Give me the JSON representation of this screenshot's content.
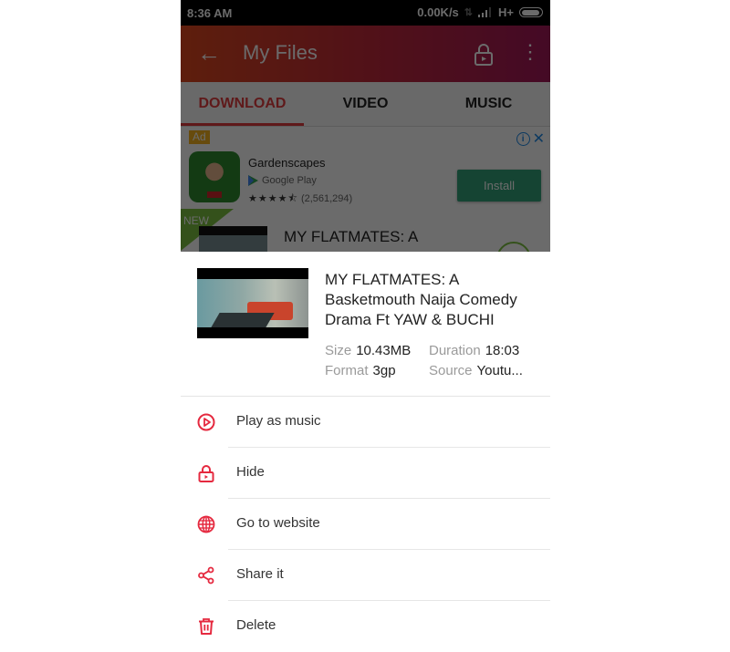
{
  "status_bar": {
    "time": "8:36 AM",
    "network_speed": "0.00K/s",
    "network_type": "H+"
  },
  "app_bar": {
    "title": "My Files",
    "icons": [
      "back-arrow-icon",
      "video-lock-icon",
      "more-vert-icon"
    ]
  },
  "tabs": [
    {
      "label": "DOWNLOAD",
      "active": true
    },
    {
      "label": "VIDEO",
      "active": false
    },
    {
      "label": "MUSIC",
      "active": false
    }
  ],
  "ad": {
    "badge": "Ad",
    "app_name": "Gardenscapes",
    "store": "Google Play",
    "stars": "★★★★⯪",
    "rating_count": "(2,561,294)",
    "install_label": "Install",
    "colors": {
      "install": "#34a37a",
      "badge": "#f5b321"
    }
  },
  "list_item": {
    "badge": "NEW",
    "title": "MY FLATMATES: A"
  },
  "sheet": {
    "title": "MY FLATMATES: A Basketmouth Naija Comedy Drama Ft YAW & BUCHI",
    "meta": {
      "size_label": "Size",
      "size_value": "10.43MB",
      "duration_label": "Duration",
      "duration_value": "18:03",
      "format_label": "Format",
      "format_value": "3gp",
      "source_label": "Source",
      "source_value": "Youtu..."
    },
    "menu": [
      {
        "label": "Play as music",
        "icon": "play-circle-icon"
      },
      {
        "label": "Hide",
        "icon": "lock-icon"
      },
      {
        "label": "Go to website",
        "icon": "globe-icon"
      },
      {
        "label": "Share it",
        "icon": "share-icon"
      },
      {
        "label": "Delete",
        "icon": "trash-icon"
      }
    ]
  },
  "colors": {
    "accent": "#e33d3f",
    "icon_red": "#e5293f",
    "appbar_gradient": [
      "#e0491f",
      "#a3185a"
    ]
  }
}
